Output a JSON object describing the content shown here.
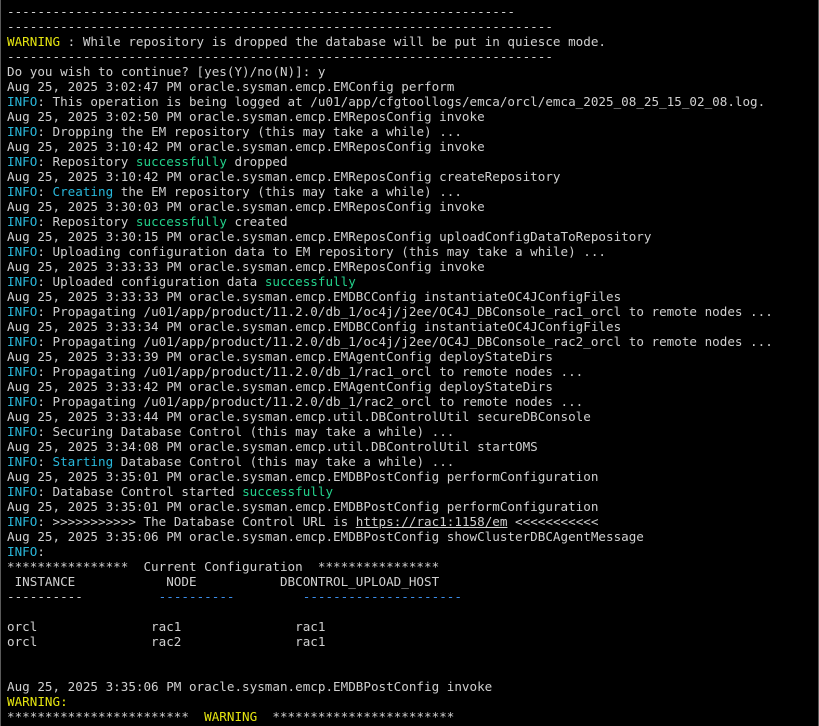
{
  "colors": {
    "background": "#000000",
    "foreground": "#d0d0d0",
    "warning": "#e5e510",
    "info": "#29b8db",
    "success": "#23d18b",
    "separator_blue": "#3b8eea"
  },
  "terminal": {
    "lines": [
      [
        {
          "t": "-------------------------------------------------------------------"
        }
      ],
      [
        {
          "t": "------------------------------------------------------------------------"
        }
      ],
      [
        {
          "t": "WARNING",
          "c": "yellow"
        },
        {
          "t": " : While repository is dropped the database will be put in quiesce mode."
        }
      ],
      [
        {
          "t": "------------------------------------------------------------------------"
        }
      ],
      [
        {
          "t": "Do you wish to continue? [yes(Y)/no(N)]: y"
        }
      ],
      [
        {
          "t": "Aug 25, 2025 3:02:47 PM oracle.sysman.emcp.EMConfig perform"
        }
      ],
      [
        {
          "t": "INFO",
          "c": "cyan"
        },
        {
          "t": ": This operation is being logged at /u01/app/cfgtoollogs/emca/orcl/emca_2025_08_25_15_02_08.log."
        }
      ],
      [
        {
          "t": "Aug 25, 2025 3:02:50 PM oracle.sysman.emcp.EMReposConfig invoke"
        }
      ],
      [
        {
          "t": "INFO",
          "c": "cyan"
        },
        {
          "t": ": Dropping the EM repository (this may take a while) ..."
        }
      ],
      [
        {
          "t": "Aug 25, 2025 3:10:42 PM oracle.sysman.emcp.EMReposConfig invoke"
        }
      ],
      [
        {
          "t": "INFO",
          "c": "cyan"
        },
        {
          "t": ": Repository "
        },
        {
          "t": "successfully",
          "c": "green"
        },
        {
          "t": " dropped"
        }
      ],
      [
        {
          "t": "Aug 25, 2025 3:10:42 PM oracle.sysman.emcp.EMReposConfig createRepository"
        }
      ],
      [
        {
          "t": "INFO",
          "c": "cyan"
        },
        {
          "t": ": "
        },
        {
          "t": "Creating",
          "c": "cyan"
        },
        {
          "t": " the EM repository (this may take a while) ..."
        }
      ],
      [
        {
          "t": "Aug 25, 2025 3:30:03 PM oracle.sysman.emcp.EMReposConfig invoke"
        }
      ],
      [
        {
          "t": "INFO",
          "c": "cyan"
        },
        {
          "t": ": Repository "
        },
        {
          "t": "successfully",
          "c": "green"
        },
        {
          "t": " created"
        }
      ],
      [
        {
          "t": "Aug 25, 2025 3:30:15 PM oracle.sysman.emcp.EMReposConfig uploadConfigDataToRepository"
        }
      ],
      [
        {
          "t": "INFO",
          "c": "cyan"
        },
        {
          "t": ": Uploading configuration data to EM repository (this may take a while) ..."
        }
      ],
      [
        {
          "t": "Aug 25, 2025 3:33:33 PM oracle.sysman.emcp.EMReposConfig invoke"
        }
      ],
      [
        {
          "t": "INFO",
          "c": "cyan"
        },
        {
          "t": ": Uploaded configuration data "
        },
        {
          "t": "successfully",
          "c": "green"
        }
      ],
      [
        {
          "t": "Aug 25, 2025 3:33:33 PM oracle.sysman.emcp.EMDBCConfig instantiateOC4JConfigFiles"
        }
      ],
      [
        {
          "t": "INFO",
          "c": "cyan"
        },
        {
          "t": ": Propagating /u01/app/product/11.2.0/db_1/oc4j/j2ee/OC4J_DBConsole_rac1_orcl to remote nodes ..."
        }
      ],
      [
        {
          "t": "Aug 25, 2025 3:33:34 PM oracle.sysman.emcp.EMDBCConfig instantiateOC4JConfigFiles"
        }
      ],
      [
        {
          "t": "INFO",
          "c": "cyan"
        },
        {
          "t": ": Propagating /u01/app/product/11.2.0/db_1/oc4j/j2ee/OC4J_DBConsole_rac2_orcl to remote nodes ..."
        }
      ],
      [
        {
          "t": "Aug 25, 2025 3:33:39 PM oracle.sysman.emcp.EMAgentConfig deployStateDirs"
        }
      ],
      [
        {
          "t": "INFO",
          "c": "cyan"
        },
        {
          "t": ": Propagating /u01/app/product/11.2.0/db_1/rac1_orcl to remote nodes ..."
        }
      ],
      [
        {
          "t": "Aug 25, 2025 3:33:42 PM oracle.sysman.emcp.EMAgentConfig deployStateDirs"
        }
      ],
      [
        {
          "t": "INFO",
          "c": "cyan"
        },
        {
          "t": ": Propagating /u01/app/product/11.2.0/db_1/rac2_orcl to remote nodes ..."
        }
      ],
      [
        {
          "t": "Aug 25, 2025 3:33:44 PM oracle.sysman.emcp.util.DBControlUtil secureDBConsole"
        }
      ],
      [
        {
          "t": "INFO",
          "c": "cyan"
        },
        {
          "t": ": Securing Database Control (this may take a while) ..."
        }
      ],
      [
        {
          "t": "Aug 25, 2025 3:34:08 PM oracle.sysman.emcp.util.DBControlUtil startOMS"
        }
      ],
      [
        {
          "t": "INFO",
          "c": "cyan"
        },
        {
          "t": ": "
        },
        {
          "t": "Starting",
          "c": "cyan"
        },
        {
          "t": " Database Control (this may take a while) ..."
        }
      ],
      [
        {
          "t": "Aug 25, 2025 3:35:01 PM oracle.sysman.emcp.EMDBPostConfig performConfiguration"
        }
      ],
      [
        {
          "t": "INFO",
          "c": "cyan"
        },
        {
          "t": ": Database Control started "
        },
        {
          "t": "successfully",
          "c": "green"
        }
      ],
      [
        {
          "t": "Aug 25, 2025 3:35:01 PM oracle.sysman.emcp.EMDBPostConfig performConfiguration"
        }
      ],
      [
        {
          "t": "INFO",
          "c": "cyan"
        },
        {
          "t": ": >>>>>>>>>>> The Database Control URL is "
        },
        {
          "t": "https://rac1:1158/em",
          "c": "link"
        },
        {
          "t": " <<<<<<<<<<<"
        }
      ],
      [
        {
          "t": "Aug 25, 2025 3:35:06 PM oracle.sysman.emcp.EMDBPostConfig showClusterDBCAgentMessage"
        }
      ],
      [
        {
          "t": "INFO",
          "c": "cyan"
        },
        {
          "t": ":"
        }
      ],
      [
        {
          "t": "****************  Current Configuration  ****************"
        }
      ],
      [
        {
          "t": " INSTANCE            NODE           DBCONTROL_UPLOAD_HOST"
        }
      ],
      [
        {
          "t": "----------          "
        },
        {
          "t": "----------",
          "c": "blue"
        },
        {
          "t": "         "
        },
        {
          "t": "---------------------",
          "c": "blue"
        }
      ],
      [
        {
          "t": ""
        }
      ],
      [
        {
          "t": "orcl               rac1               rac1"
        }
      ],
      [
        {
          "t": "orcl               rac2               rac1"
        }
      ],
      [
        {
          "t": ""
        }
      ],
      [
        {
          "t": ""
        }
      ],
      [
        {
          "t": "Aug 25, 2025 3:35:06 PM oracle.sysman.emcp.EMDBPostConfig invoke"
        }
      ],
      [
        {
          "t": "WARNING:",
          "c": "yellow"
        }
      ],
      [
        {
          "t": "************************  "
        },
        {
          "t": "WARNING",
          "c": "yellow"
        },
        {
          "t": "  ************************"
        }
      ]
    ]
  }
}
